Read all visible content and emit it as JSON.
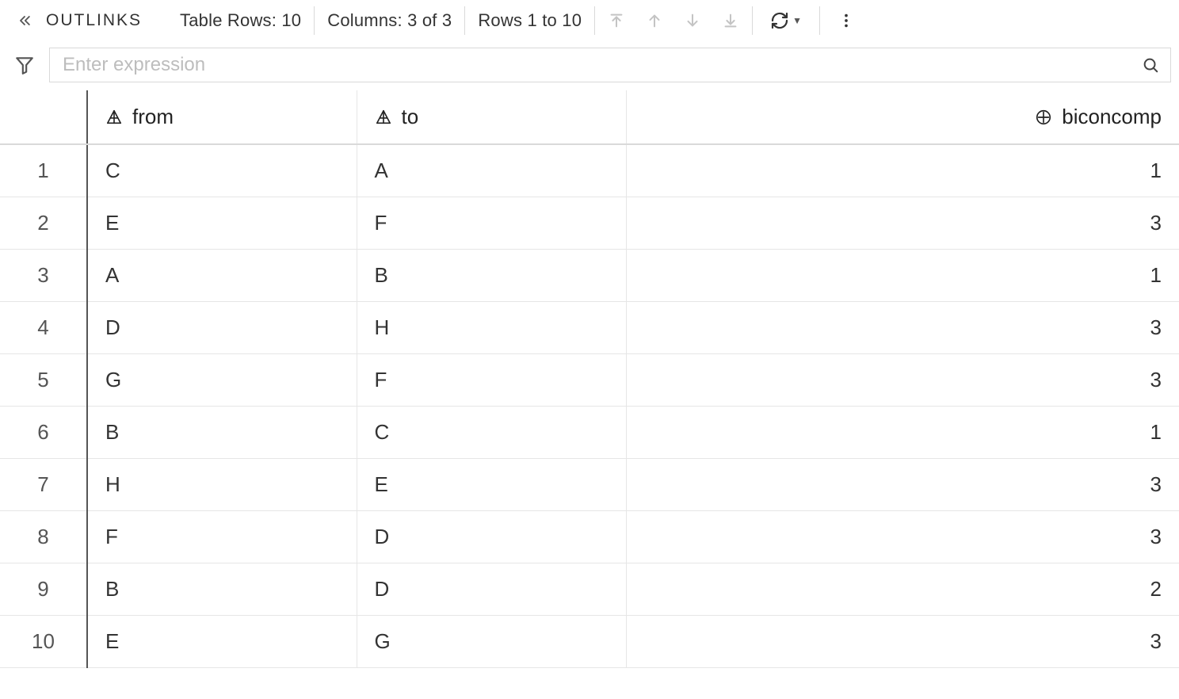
{
  "toolbar": {
    "title": "OUTLINKS",
    "rows_label": "Table Rows: 10",
    "cols_label": "Columns: 3 of 3",
    "range_label": "Rows 1 to 10"
  },
  "filter": {
    "placeholder": "Enter expression",
    "value": ""
  },
  "columns": [
    {
      "key": "from",
      "label": "from",
      "type": "text"
    },
    {
      "key": "to",
      "label": "to",
      "type": "text"
    },
    {
      "key": "biconcomp",
      "label": "biconcomp",
      "type": "number"
    }
  ],
  "rows": [
    {
      "n": 1,
      "from": "C",
      "to": "A",
      "biconcomp": 1
    },
    {
      "n": 2,
      "from": "E",
      "to": "F",
      "biconcomp": 3
    },
    {
      "n": 3,
      "from": "A",
      "to": "B",
      "biconcomp": 1
    },
    {
      "n": 4,
      "from": "D",
      "to": "H",
      "biconcomp": 3
    },
    {
      "n": 5,
      "from": "G",
      "to": "F",
      "biconcomp": 3
    },
    {
      "n": 6,
      "from": "B",
      "to": "C",
      "biconcomp": 1
    },
    {
      "n": 7,
      "from": "H",
      "to": "E",
      "biconcomp": 3
    },
    {
      "n": 8,
      "from": "F",
      "to": "D",
      "biconcomp": 3
    },
    {
      "n": 9,
      "from": "B",
      "to": "D",
      "biconcomp": 2
    },
    {
      "n": 10,
      "from": "E",
      "to": "G",
      "biconcomp": 3
    }
  ]
}
